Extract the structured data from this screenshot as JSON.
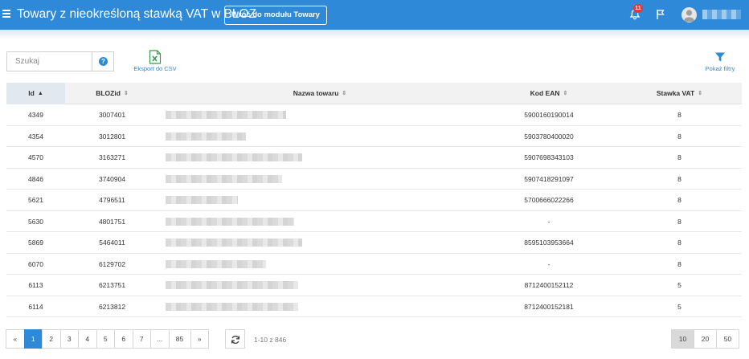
{
  "header": {
    "title": "Towary z nieokreśloną stawką VAT w BLOZ",
    "back_button": "Wróć do modułu Towary",
    "notifications_count": "11"
  },
  "toolbar": {
    "search_placeholder": "Szukaj",
    "help_label": "?",
    "export_label": "Eksport do CSV",
    "filters_label": "Pokaż filtry"
  },
  "table": {
    "columns": [
      "Id",
      "BLOZid",
      "Nazwa towaru",
      "Kod EAN",
      "Stawka VAT"
    ],
    "sorted_column": "Id",
    "rows": [
      {
        "id": "4349",
        "bloz": "3007401",
        "ean": "5900160190014",
        "vat": "8"
      },
      {
        "id": "4354",
        "bloz": "3012801",
        "ean": "5903780400020",
        "vat": "8"
      },
      {
        "id": "4570",
        "bloz": "3163271",
        "ean": "5907698343103",
        "vat": "8"
      },
      {
        "id": "4846",
        "bloz": "3740904",
        "ean": "5907418291097",
        "vat": "8"
      },
      {
        "id": "5621",
        "bloz": "4796511",
        "ean": "5700666022266",
        "vat": "8"
      },
      {
        "id": "5630",
        "bloz": "4801751",
        "ean": "-",
        "vat": "8"
      },
      {
        "id": "5869",
        "bloz": "5464011",
        "ean": "8595103953664",
        "vat": "8"
      },
      {
        "id": "6070",
        "bloz": "6129702",
        "ean": "-",
        "vat": "8"
      },
      {
        "id": "6113",
        "bloz": "6213751",
        "ean": "8712400152112",
        "vat": "5"
      },
      {
        "id": "6114",
        "bloz": "6213812",
        "ean": "8712400152181",
        "vat": "5"
      }
    ]
  },
  "pagination": {
    "prev": "«",
    "pages": [
      "1",
      "2",
      "3",
      "4",
      "5",
      "6",
      "7",
      "...",
      "85"
    ],
    "next": "»",
    "active_page": "1",
    "range_text": "1-10 z 846",
    "page_sizes": [
      "10",
      "20",
      "50"
    ],
    "active_size": "10"
  },
  "colors": {
    "header_bg": "#2e8ad8",
    "badge": "#e53935",
    "excel": "#2e9e4a"
  }
}
